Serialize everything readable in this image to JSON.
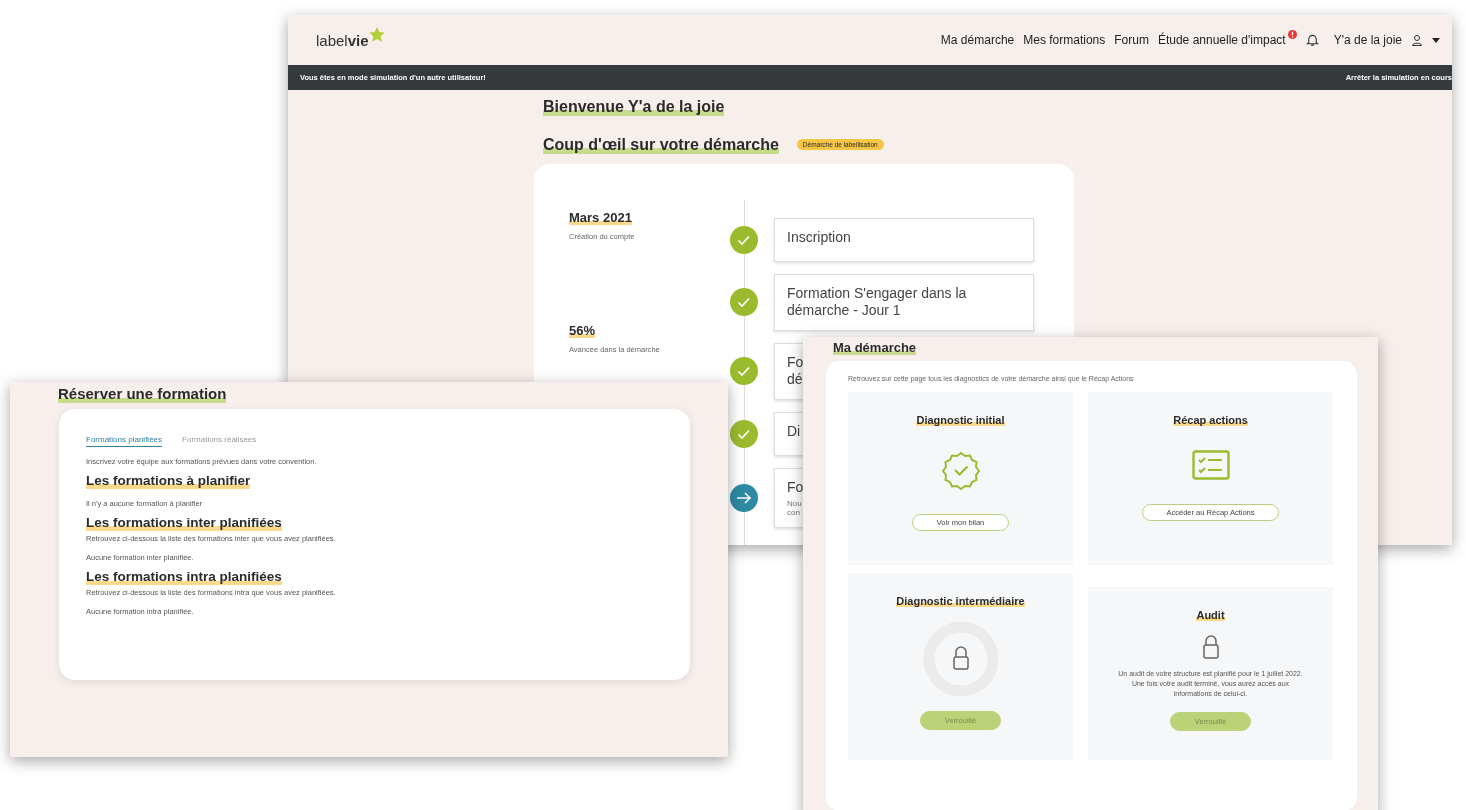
{
  "main_window": {
    "logo": "label**vie**",
    "nav": [
      {
        "label": "Ma démarche",
        "alert": false
      },
      {
        "label": "Mes formations",
        "alert": false
      },
      {
        "label": "Forum",
        "alert": false
      },
      {
        "label": "Étude annuelle d'impact",
        "alert": true
      }
    ],
    "user": "Y'a de la joie",
    "simulation_banner": {
      "message": "Vous êtes en mode simulation d'un autre utilisateur!",
      "action": "Arrêter la simulation en cours"
    },
    "welcome": "Bienvenue Y'a de la joie",
    "overview_title": "Coup d'œil sur votre démarche",
    "overview_badge": "Démarche de labellisation",
    "stats": [
      {
        "value": "Mars 2021",
        "label": "Création du compte"
      },
      {
        "value": "56%",
        "label": "Avancée dans la démarche"
      }
    ],
    "steps": [
      {
        "title": "Inscription",
        "kind": "done"
      },
      {
        "title": "Formation S'engager dans la démarche - Jour 1",
        "kind": "done"
      },
      {
        "title": "Fo\ndé",
        "kind": "done"
      },
      {
        "title": "Di",
        "kind": "done"
      },
      {
        "title": "Fo",
        "note": "Nou\ncon",
        "kind": "current"
      }
    ]
  },
  "booking_window": {
    "title": "Réserver une formation",
    "tabs": [
      {
        "label": "Formations planifiées",
        "selected": true
      },
      {
        "label": "Formations réalisées",
        "selected": false
      }
    ],
    "intro": "Inscrivez votre équipe aux formations prévues dans votre convention.",
    "sections": [
      {
        "heading": "Les formations à planifier",
        "empty": "Il n'y a aucune formation à planifier"
      },
      {
        "heading": "Les formations inter planifiées",
        "description": "Retrouvez ci-dessous la liste des formations inter que vous avez planifiées.",
        "empty": "Aucune formation inter planifiée."
      },
      {
        "heading": "Les formations intra planifiées",
        "description": "Retrouvez ci-dessous la liste des formations intra que vous avez planifiées.",
        "empty": "Aucune formation intra planifiée."
      }
    ]
  },
  "approach_window": {
    "title": "Ma démarche",
    "intro": "Retrouvez sur cette page tous les diagnostics de votre démarche ainsi que le Récap Actions",
    "cards": [
      {
        "title": "Diagnostic initial",
        "kind": "badge",
        "button": "Voir mon bilan",
        "locked": false
      },
      {
        "title": "Récap actions",
        "kind": "list",
        "button": "Accéder au Récap Actions",
        "locked": false
      },
      {
        "title": "Diagnostic intermédiaire",
        "kind": "ring",
        "button": "Verrouillé",
        "locked": true
      },
      {
        "title": "Audit",
        "kind": "lock",
        "text": "Un audit de votre structure est planifié pour le 1 juillet 2022.\nUne fois votre audit terminé, vous aurez accès aux informations de celui-ci.",
        "button": "Verrouillé",
        "locked": true
      }
    ]
  }
}
